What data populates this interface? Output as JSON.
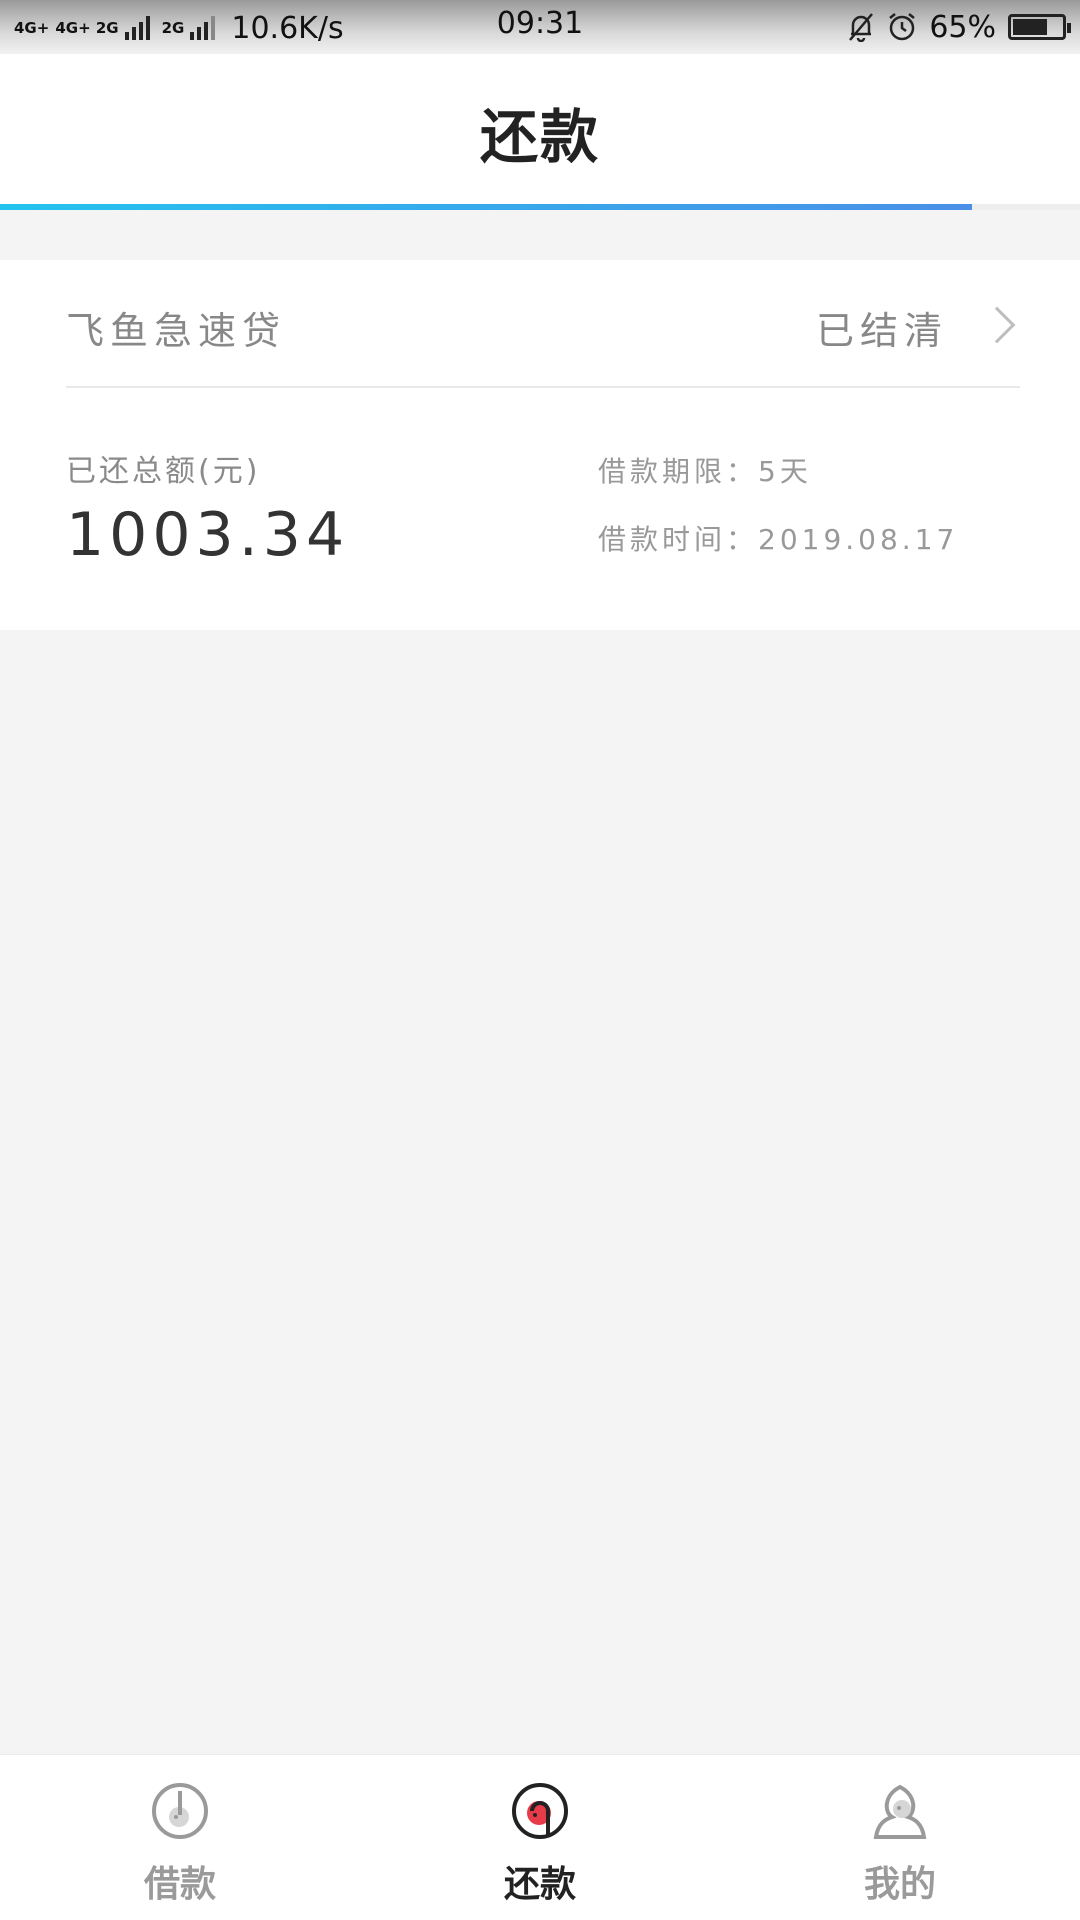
{
  "status_bar": {
    "network_1": "4G+",
    "network_2": "4G+ 2G",
    "network_3": "2G",
    "speed": "10.6K/s",
    "time": "09:31",
    "battery": "65%",
    "battery_level": 0.65,
    "icons": [
      "mute-icon",
      "alarm-icon",
      "battery-icon"
    ]
  },
  "header": {
    "title": "还款",
    "progress": 0.9,
    "progress_colors": [
      "#23c3ef",
      "#4a8fe8"
    ]
  },
  "loan": {
    "product_name": "飞鱼急速贷",
    "status": "已结清",
    "paid_label": "已还总额(元)",
    "paid_amount": "1003.34",
    "term": "借款期限：5天",
    "borrow_time": "借款时间：2019.08.17"
  },
  "bottom_nav": {
    "items": [
      {
        "label": "借款",
        "icon": "borrow-icon",
        "active": false
      },
      {
        "label": "还款",
        "icon": "repay-icon",
        "active": true
      },
      {
        "label": "我的",
        "icon": "profile-icon",
        "active": false
      }
    ],
    "active_color": "#e83b4a"
  }
}
